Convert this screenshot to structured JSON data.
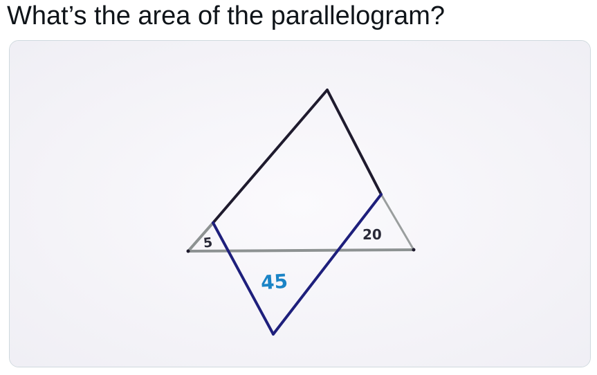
{
  "post": {
    "question_text": "What’s the area of the parallelogram?"
  },
  "figure": {
    "labels": {
      "small_triangle": "5",
      "right_triangle": "20",
      "lower_triangle": "45"
    },
    "colors": {
      "paper": "#f7f6fa",
      "outline_dark": "#1f1b2e",
      "outline_grey": "#8d9292",
      "parallelogram_blue": "#1e1f7c",
      "label_dark": "#2a2a38",
      "label_blue": "#1b84c6"
    }
  }
}
